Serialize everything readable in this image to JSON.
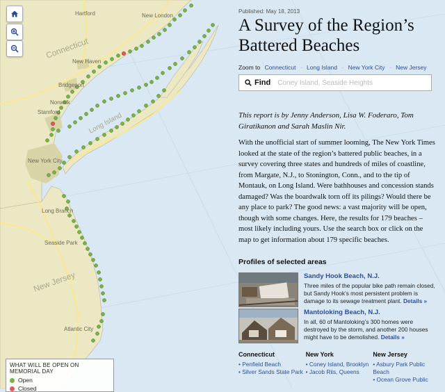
{
  "map": {
    "labels": {
      "hartford": "Hartford",
      "new_london": "New London",
      "connecticut": "Connecticut",
      "new_haven": "New Haven",
      "bridgeport": "Bridgeport",
      "norwalk": "Norwalk",
      "stamford": "Stamford",
      "long_island": "Long Island",
      "new_york_city": "New York City",
      "long_branch": "Long Branch",
      "seaside_park": "Seaside Park",
      "new_jersey": "New Jersey",
      "atlantic_city": "Atlantic City"
    },
    "colors": {
      "land": "#ece8c4",
      "water": "#d9e8f3",
      "urban": "#d8d4a8",
      "open": "#7ab04a",
      "closed": "#e05a5a",
      "road": "#fbe78f"
    },
    "zoom_icons": [
      "home-icon",
      "zoom-in-icon",
      "zoom-out-icon"
    ],
    "legend": {
      "title": "What will be open on Memorial Day",
      "open": "Open",
      "closed": "Closed"
    }
  },
  "article": {
    "published": "Published: May 18, 2013",
    "headline": "A Survey of the Region’s Battered Beaches",
    "zoom_to": {
      "label": "Zoom to",
      "links": [
        "Connecticut",
        "Long Island",
        "New York City",
        "New Jersey"
      ]
    },
    "find": {
      "label": "Find",
      "placeholder": "Coney Island, Seaside Heights"
    },
    "byline": "This report is by Jenny Anderson, Lisa W. Foderaro, Tom Giratikanon and Sarah Maslin Nir.",
    "body": "With the unofficial start of summer looming, The New York Times looked at the state of the region’s battered public beaches, in a survey covering three states and hundreds of miles of coastline, from Margate, N.J., to Stonington, Conn., and to the tip of Montauk, on Long Island. Were bathhouses and concession stands damaged? Was the boardwalk torn off its pilings? Would there be any place to park? The good news: a vast majority will be open, though with some changes. Here, the results for 179 beaches – most likely including yours. Use the search box or click on the map to get information about 179 specific beaches.",
    "profiles_heading": "Profiles of selected areas",
    "profiles": [
      {
        "title": "Sandy Hook Beach, N.J.",
        "desc": "Three miles of the popular bike path remain closed, but Sandy Hook’s most persistent problem is damage to its sewage treatment plant.",
        "more": "Details »"
      },
      {
        "title": "Mantoloking Beach, N.J.",
        "desc": "In all, 60 of Mantoloking’s 300 homes were destroyed by the storm, and another 200 houses might have to be demolished.",
        "more": "Details »"
      }
    ],
    "states": [
      {
        "name": "Connecticut",
        "items": [
          "• Penfield Beach",
          "• Silver Sands State Park"
        ]
      },
      {
        "name": "New York",
        "items": [
          "• Coney Island, Brooklyn",
          "• Jacob Riis, Queens"
        ]
      },
      {
        "name": "New Jersey",
        "items": [
          "• Asbury Park Public Beach",
          "• Ocean Grove Public"
        ]
      }
    ]
  }
}
